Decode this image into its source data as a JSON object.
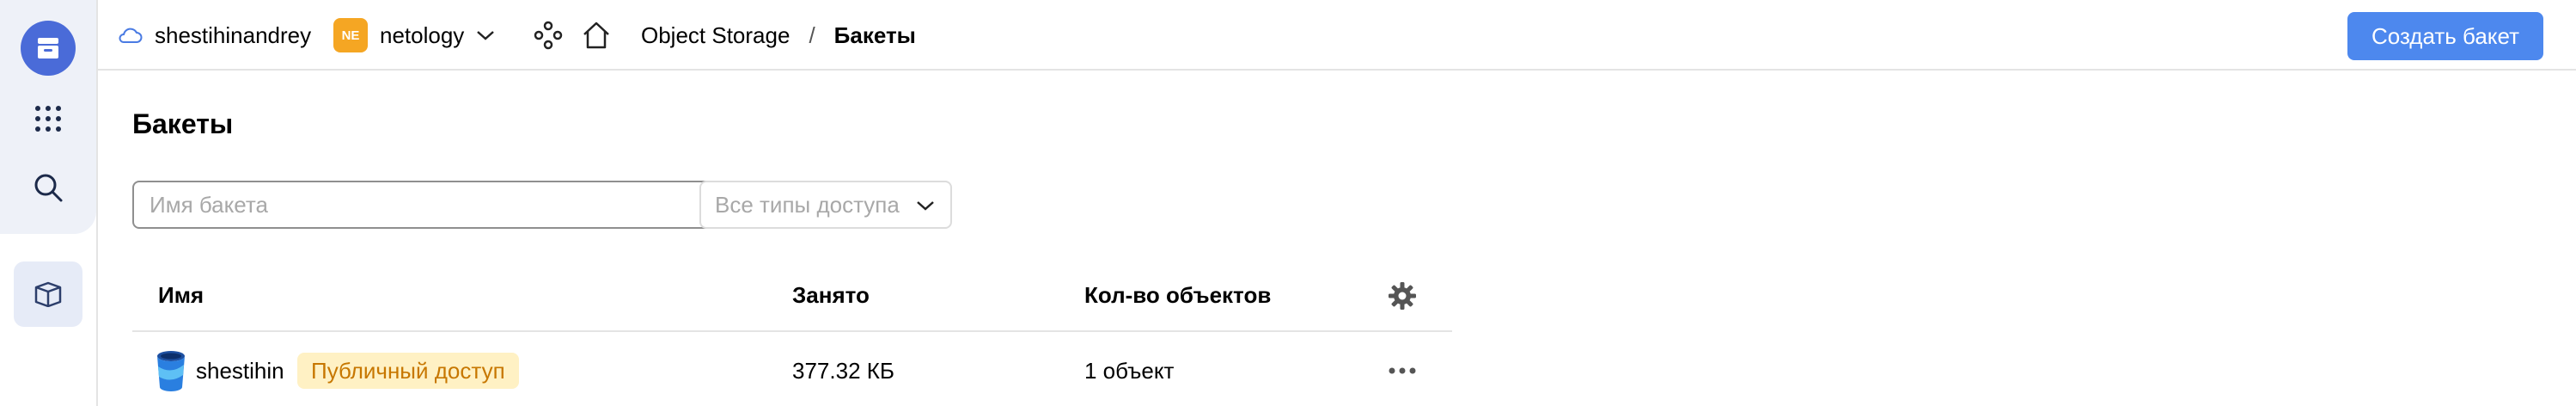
{
  "header": {
    "cloud_name": "shestihinandrey",
    "org_badge": "NE",
    "org_name": "netology",
    "breadcrumb_service": "Object Storage",
    "breadcrumb_separator": "/",
    "breadcrumb_current": "Бакеты",
    "create_button_label": "Создать бакет"
  },
  "sidebar": {
    "items": [
      {
        "icon": "storage-service-icon"
      },
      {
        "icon": "all-services-grid-icon"
      },
      {
        "icon": "search-icon"
      },
      {
        "icon": "buckets-box-icon"
      }
    ]
  },
  "page": {
    "title": "Бакеты",
    "search_placeholder": "Имя бакета",
    "access_filter_value": "Все типы доступа"
  },
  "table": {
    "columns": [
      "Имя",
      "Занято",
      "Кол-во объектов"
    ],
    "rows": [
      {
        "name": "shestihin",
        "access_badge": "Публичный доступ",
        "size": "377.32 КБ",
        "objects": "1 объект"
      }
    ]
  },
  "colors": {
    "accent": "#4d88ee",
    "rail_primary": "#4a6bd8",
    "org_badge": "#f5a623",
    "public_badge_bg": "#fff1c4",
    "public_badge_text": "#c77700"
  }
}
